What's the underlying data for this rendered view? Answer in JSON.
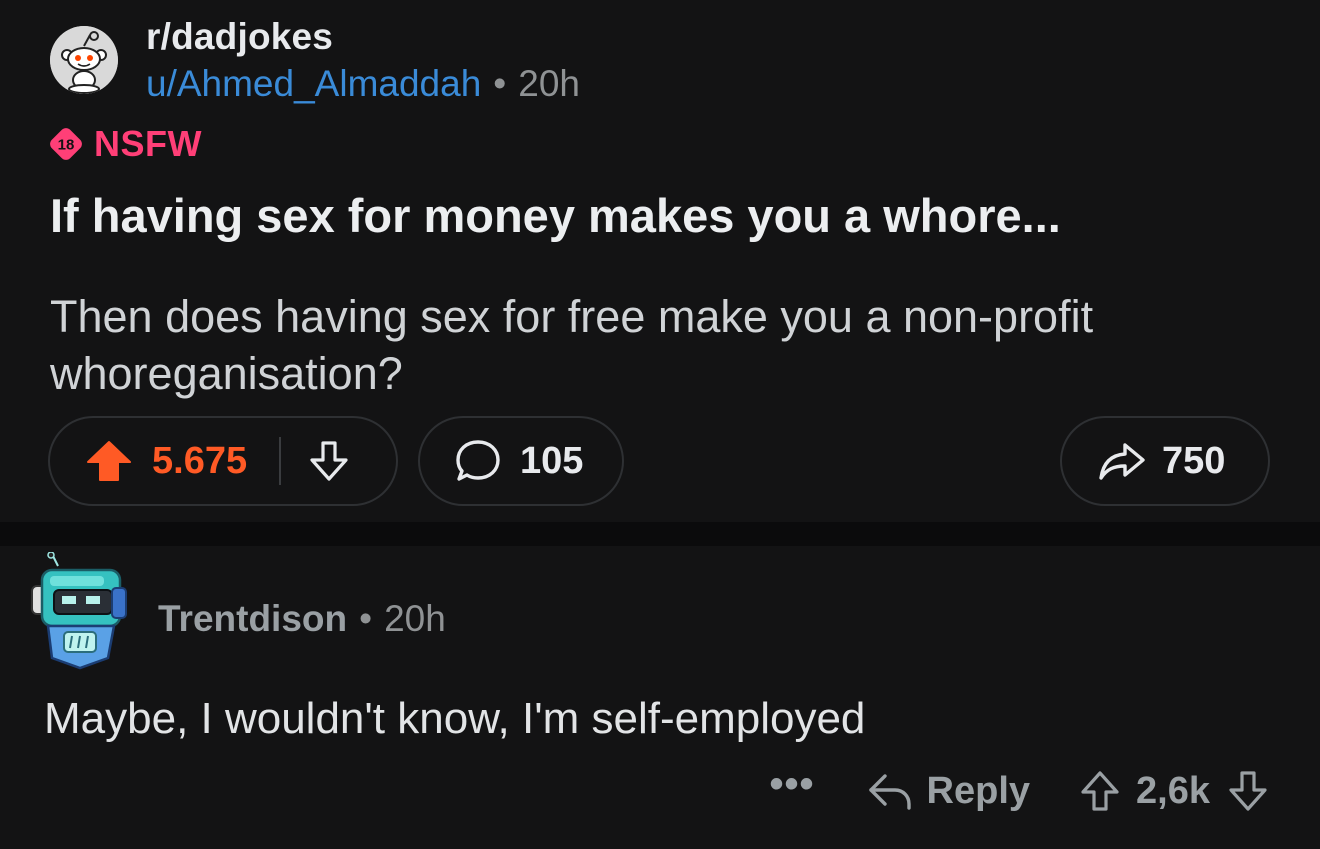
{
  "post": {
    "subreddit": "r/dadjokes",
    "author": "u/Ahmed_Almaddah",
    "separator": "•",
    "age": "20h",
    "nsfw": {
      "badge": "18",
      "label": "NSFW"
    },
    "title": "If having sex for money makes you a whore...",
    "body": "Then does having sex for free make you a non-profit whoreganisation?",
    "actions": {
      "score": "5.675",
      "comments": "105",
      "shares": "750"
    }
  },
  "comment": {
    "username": "Trentdison",
    "separator": "•",
    "age": "20h",
    "text": "Maybe, I wouldn't know, I'm self-employed",
    "more": "•••",
    "reply_label": "Reply",
    "score": "2,6k"
  },
  "colors": {
    "background": "#131314",
    "upvote_active": "#ff5a25",
    "nsfw": "#ff3f77",
    "author_link": "#3a8bd8"
  },
  "icons": {
    "subreddit_avatar": "reddit-snoo-icon",
    "upvote": "arrow-up-filled-icon",
    "downvote": "arrow-down-outline-icon",
    "comments": "speech-bubble-icon",
    "share": "share-arrow-icon",
    "reply": "reply-arrow-icon",
    "comment_avatar": "robot-avatar-icon"
  }
}
